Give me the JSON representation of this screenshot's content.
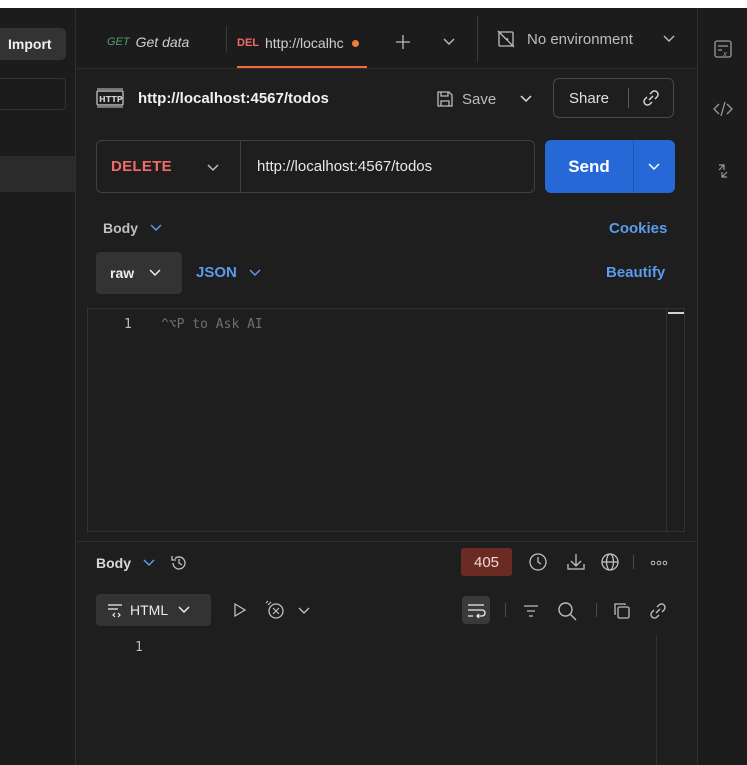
{
  "left_panel": {
    "import_label": "Import"
  },
  "tabs": [
    {
      "method": "GET",
      "title": "Get data"
    },
    {
      "method": "DEL",
      "title": "http://localhc"
    }
  ],
  "environment": {
    "label": "No environment"
  },
  "request": {
    "name": "http://localhost:4567/todos",
    "save_label": "Save",
    "share_label": "Share",
    "method": "DELETE",
    "url": "http://localhost:4567/todos",
    "send_label": "Send"
  },
  "body_section": {
    "body_label": "Body",
    "cookies_label": "Cookies",
    "raw_label": "raw",
    "json_label": "JSON",
    "beautify_label": "Beautify",
    "editor_line": "1",
    "editor_placeholder": "^⌥P to Ask AI"
  },
  "response": {
    "body_label": "Body",
    "status_code": "405",
    "format_label": "HTML",
    "line": "1"
  },
  "colors": {
    "accent_blue": "#2568d6",
    "link_blue": "#5b9aed",
    "delete_red": "#f16b6b",
    "get_green": "#4fa16a",
    "status_bg": "#6b2b22"
  }
}
